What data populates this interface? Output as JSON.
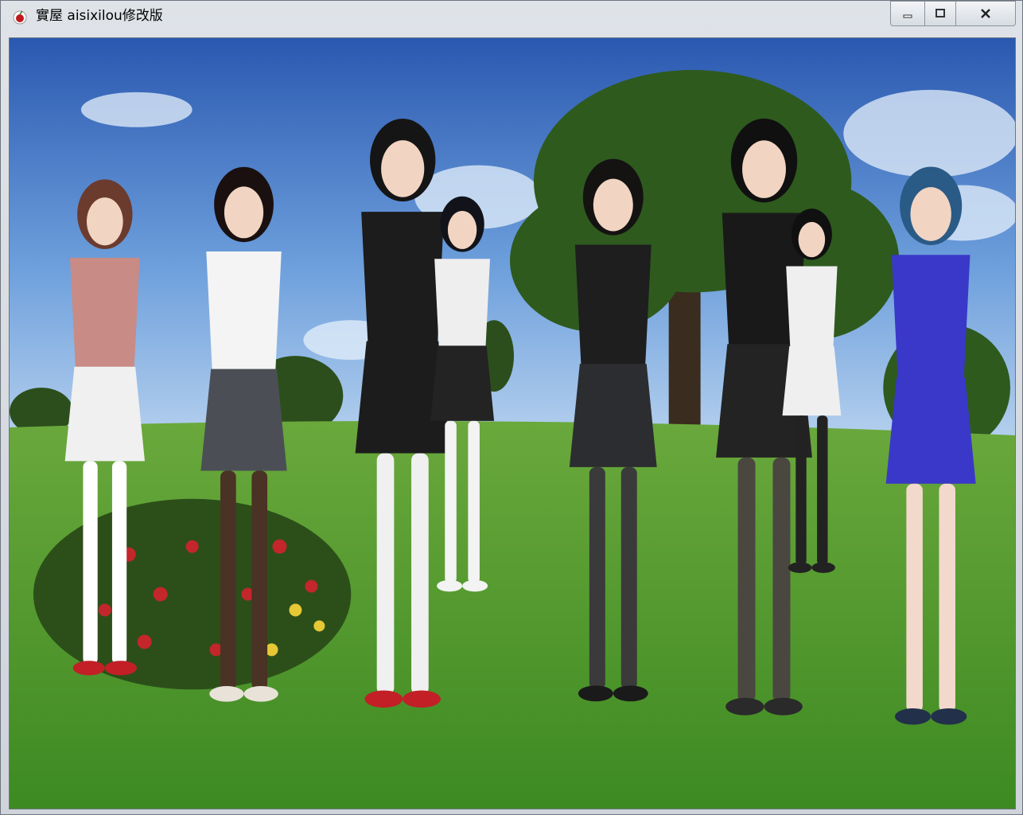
{
  "window": {
    "title": "實屋 aisixilou修改版",
    "icon": "cherry-icon",
    "controls": [
      "minimize-icon",
      "maximize-icon",
      "close-icon"
    ]
  },
  "scene": {
    "description_colors": {
      "sky_top": "#2f5fb8",
      "sky_bottom": "#8fb7e6",
      "grass": "#4f9a2e",
      "tree": "#2f5a1c"
    },
    "characters": [
      {
        "outfit": "pink-cardigan-white-skirt",
        "hair": "#6b3b2e",
        "top": "#c98b86",
        "skirt": "#f0f0f0",
        "legs": "#ffffff",
        "shoes": "#c21f27"
      },
      {
        "outfit": "white-blouse-gray-skirt",
        "hair": "#1a1010",
        "top": "#f4f4f4",
        "skirt": "#4b4f55",
        "legs": "#4a3224",
        "shoes": "#e8e2d8"
      },
      {
        "outfit": "black-blazer-black-skirt",
        "hair": "#151515",
        "top": "#1c1c1c",
        "skirt": "#1c1c1c",
        "legs": "#f0f0f0",
        "shoes": "#c21f27"
      },
      {
        "outfit": "back-view-white-shirt",
        "hair": "#12131a",
        "top": "#eeeeee",
        "skirt": "#232323",
        "legs": "#f3f3f3",
        "shoes": "#f3f3f3"
      },
      {
        "outfit": "black-suit",
        "hair": "#151212",
        "top": "#1e1e1e",
        "skirt": "#2c2d30",
        "legs": "#3a3a3a",
        "shoes": "#1a1a1a"
      },
      {
        "outfit": "black-backless-dress",
        "hair": "#101010",
        "top": "#191919",
        "skirt": "#232323",
        "legs": "#4a4640",
        "shoes": "#2a2a2a"
      },
      {
        "outfit": "white-dress-back",
        "hair": "#101010",
        "top": "#efefef",
        "skirt": "#efefef",
        "legs": "#222222",
        "shoes": "#222222"
      },
      {
        "outfit": "blue-sheer-dress",
        "hair": "#2a5a86",
        "top": "#3a38c8",
        "skirt": "#3a38c8",
        "legs": "#f2d9cc",
        "shoes": "#22304a"
      }
    ]
  }
}
